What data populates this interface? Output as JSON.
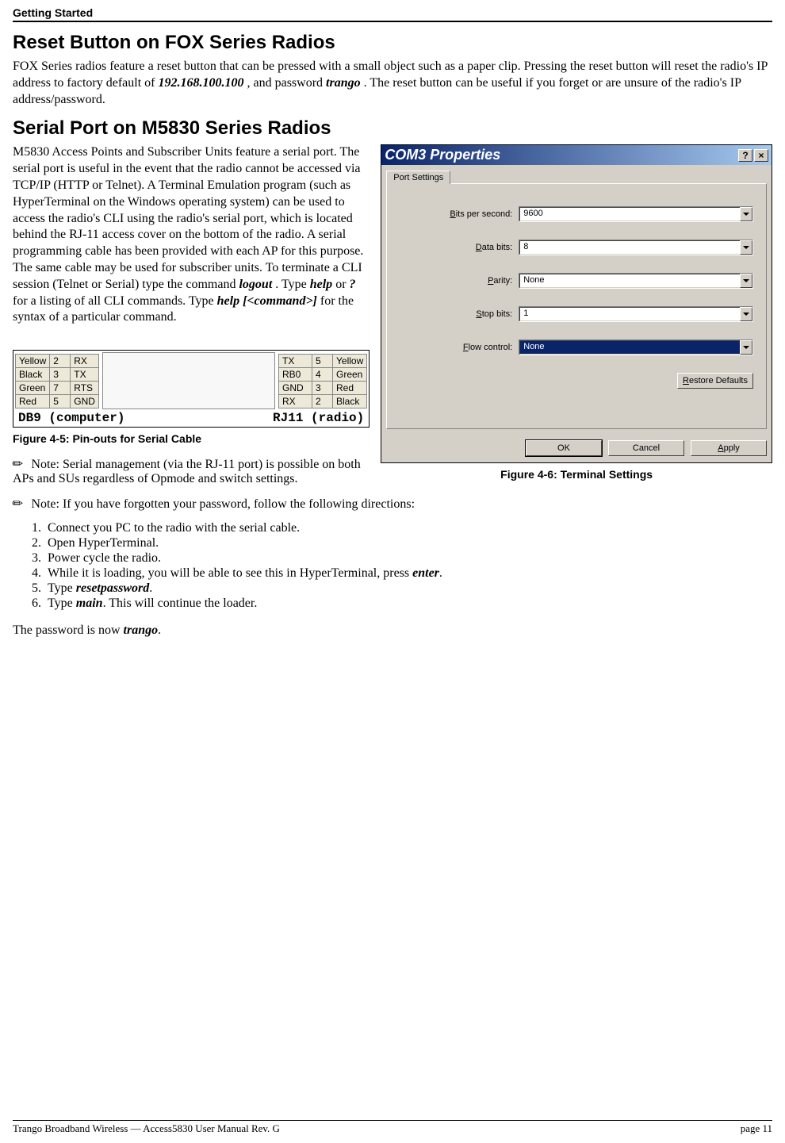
{
  "header": {
    "section": "Getting Started"
  },
  "h1a": "Reset Button on FOX Series Radios",
  "p1a": "FOX Series radios feature a reset button that can be pressed with a small object such as a paper clip.  Pressing the reset button will reset the radio's IP address to factory default of ",
  "p1_ip": "192.168.100.100",
  "p1b": ", and password ",
  "p1_pw": "trango",
  "p1c": ".  The reset button can be useful if you forget or are unsure of the radio's IP address/password.",
  "h1b": "Serial Port on M5830 Series Radios",
  "p2a": "M5830 Access Points and Subscriber Units feature a serial port.  The serial port is useful in the event that the radio cannot be accessed via TCP/IP (HTTP or Telnet).  A Terminal Emulation program (such as HyperTerminal on the Windows operating system) can be used to access the radio's CLI using the radio's serial port, which is located behind the RJ-11 access cover on the bottom of the radio.  A serial programming cable has been provided with each AP for this purpose.  The same cable may be used for subscriber units.  To terminate a CLI session (Telnet or Serial) type the command ",
  "p2_logout": "logout",
  "p2b": ".  Type ",
  "p2_help": "help",
  "p2c": " or ",
  "p2_q": "?",
  "p2d": " for a listing of all CLI commands.  Type ",
  "p2_helpcmd": "help [<command>]",
  "p2e": " for the syntax of a particular command.",
  "pinout": {
    "left": [
      [
        "Yellow",
        "2",
        "RX"
      ],
      [
        "Black",
        "3",
        "TX"
      ],
      [
        "Green",
        "7",
        "RTS"
      ],
      [
        "Red",
        "5",
        "GND"
      ]
    ],
    "right": [
      [
        "TX",
        "5",
        "Yellow"
      ],
      [
        "RB0",
        "4",
        "Green"
      ],
      [
        "GND",
        "3",
        "Red"
      ],
      [
        "RX",
        "2",
        "Black"
      ]
    ],
    "label_left": "DB9 (computer)",
    "label_right": "RJ11 (radio)"
  },
  "fig45": "Figure 4-5: Pin-outs for Serial Cable",
  "note1": "  Note:  Serial management (via the RJ-11 port) is possible on both APs and SUs regardless of Opmode and switch settings.",
  "com": {
    "title": "COM3 Properties",
    "tab": "Port Settings",
    "fields": {
      "bps": {
        "label_pre": "",
        "ul": "B",
        "label_post": "its per second:",
        "value": "9600",
        "selected": false
      },
      "data": {
        "label_pre": "",
        "ul": "D",
        "label_post": "ata bits:",
        "value": "8",
        "selected": false
      },
      "parity": {
        "label_pre": "",
        "ul": "P",
        "label_post": "arity:",
        "value": "None",
        "selected": false
      },
      "stop": {
        "label_pre": "",
        "ul": "S",
        "label_post": "top bits:",
        "value": "1",
        "selected": false
      },
      "flow": {
        "label_pre": "",
        "ul": "F",
        "label_post": "low control:",
        "value": "None",
        "selected": true
      }
    },
    "restore_pre": "",
    "restore_ul": "R",
    "restore_post": "estore Defaults",
    "ok": "OK",
    "cancel": "Cancel",
    "apply_pre": "",
    "apply_ul": "A",
    "apply_post": "pply"
  },
  "fig46": "Figure 4-6:  Terminal Settings",
  "note2": "  Note:  If you have forgotten your password, follow the following directions:",
  "steps": {
    "s1": "Connect you PC to the radio with the serial cable.",
    "s2": "Open HyperTerminal.",
    "s3": "Power cycle the radio.",
    "s4a": "While it is loading, you will be able to see this in HyperTerminal, press ",
    "s4b": "enter",
    "s4c": ".",
    "s5a": "Type ",
    "s5b": "resetpassword",
    "s5c": ".",
    "s6a": "Type ",
    "s6b": "main",
    "s6c": ".  This will continue the loader."
  },
  "after_a": "The password is now ",
  "after_b": "trango",
  "after_c": ".",
  "footer": {
    "left": "Trango Broadband Wireless — Access5830 User Manual  Rev. G",
    "right": "page 11"
  }
}
